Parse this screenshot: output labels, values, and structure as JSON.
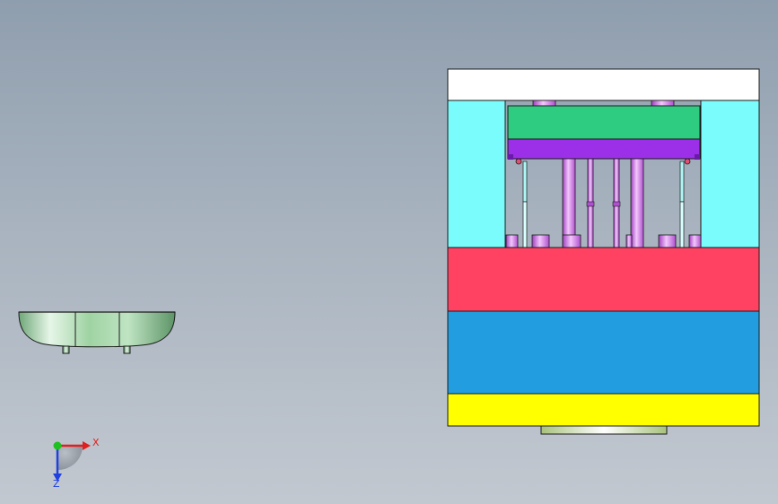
{
  "viewport": {
    "background_top": "#8f9eae",
    "background_bottom": "#c2c8d0"
  },
  "part_preview": {
    "color": "#9fd3a3",
    "edge_color": "#1a1a1a"
  },
  "mold_assembly": {
    "top_clamp_plate_color": "#ffffff",
    "side_block_color": "#7afcfc",
    "ejector_retainer_color": "#2ecc80",
    "ejector_plate_color": "#9b30e8",
    "pin_color": "#d480e6",
    "cavity_plate_color": "#ff4262",
    "core_plate_color": "#229ddf",
    "bottom_clamp_plate_color": "#ffff00",
    "locating_ring_color": "#d7edb0"
  },
  "triad": {
    "x_label": "X",
    "z_label": "Z",
    "x_color": "#e02020",
    "y_color": "#20c020",
    "z_color": "#2040e0"
  }
}
